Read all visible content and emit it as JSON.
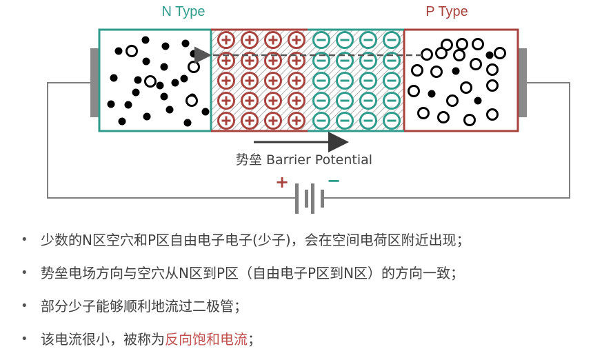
{
  "diagram": {
    "n_label": "N Type",
    "p_label": "P Type",
    "barrier_label": "势垒 Barrier Potential",
    "battery_plus": "+",
    "battery_minus": "−",
    "plus_glyph": "+",
    "minus_glyph": "−",
    "colors": {
      "n_region": "#2e9c8c",
      "p_region": "#a8423c",
      "wire": "#7f7f7f",
      "text": "#404040"
    },
    "depletion": {
      "positive_ion_columns": 4,
      "negative_ion_columns": 4,
      "rows": 5
    }
  },
  "bullets": [
    {
      "text": "少数的N区空穴和P区自由电子电子(少子)，会在空间电荷区附近出现；"
    },
    {
      "text": "势垒电场方向与空穴从N区到P区（自由电子P区到N区）的方向一致；"
    },
    {
      "text": "部分少子能够顺利地流过二极管；"
    },
    {
      "text": "该电流很小，被称为",
      "highlight": "反向饱和电流",
      "suffix": "；"
    }
  ]
}
